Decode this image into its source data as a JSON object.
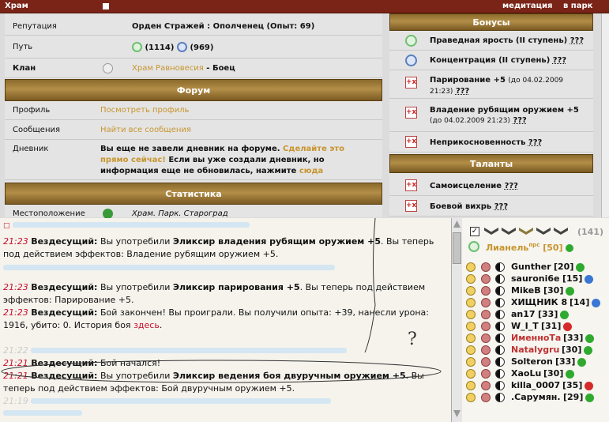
{
  "topbar": {
    "title": "Храм",
    "meditation": "медитация",
    "location": "в парк"
  },
  "profile": {
    "reputation_label": "Репутация",
    "reputation_value": "Орден Стражей : Ополченец (Опыт: 69)",
    "path_label": "Путь",
    "path_green": "(1114)",
    "path_blue": "(969)",
    "clan_label": "Клан",
    "clan_name": "Храм Равновесия",
    "clan_role": " - Боец"
  },
  "forum": {
    "title": "Форум",
    "profile_label": "Профиль",
    "profile_link": "Посмотреть профиль",
    "messages_label": "Сообщения",
    "messages_link": "Найти все сообщения",
    "diary_label": "Дневник",
    "diary_text1": "Вы еще не завели дневник на форуме.",
    "diary_link": "Сделайте это прямо сейчас!",
    "diary_text2": "Если вы уже создали дневник, но информация еще не обновилась, нажмите",
    "diary_link2": "сюда"
  },
  "stats": {
    "title": "Статистика",
    "location_label": "Местоположение",
    "location_value": "Храм. Парк. Староград"
  },
  "bonuses": {
    "title": "Бонусы",
    "items": [
      {
        "name": "Праведная ярость (II ступень)",
        "q": "???",
        "icon": "green-circle-icon"
      },
      {
        "name": "Концентрация (II ступень)",
        "q": "???",
        "icon": "blue-circle-icon"
      },
      {
        "name": "Парирование +5",
        "date": "(до 04.02.2009 21:23)",
        "q": "???",
        "icon": "plus-x-icon"
      },
      {
        "name": "Владение рубящим оружием +5",
        "date": "(до 04.02.2009 21:23)",
        "q": "???",
        "icon": "plus-x-icon"
      },
      {
        "name": "Неприкосновенность",
        "q": "???",
        "icon": "plus-x-icon"
      }
    ]
  },
  "talents": {
    "title": "Таланты",
    "items": [
      {
        "name": "Самоисцеление",
        "q": "???"
      },
      {
        "name": "Боевой вихрь",
        "q": "???"
      }
    ]
  },
  "chat": [
    {
      "time": "21:23",
      "who": "Вездесущий:",
      "text": "Вы употребили ",
      "item": "Эликсир владения рубящим оружием +5",
      "rest": ". Вы теперь под действием эффектов: Владение рубящим оружием +5."
    },
    {
      "time": "21:23",
      "who": "Вездесущий:",
      "text": "Вы употребили ",
      "item": "Эликсир парирования +5",
      "rest": ". Вы теперь под действием эффектов: Парирование +5."
    },
    {
      "time": "21:23",
      "who": "Вездесущий:",
      "text": "Бой закончен! Вы проиграли. Вы получили опыта: +39, нанесли урона: 1916, убито: 0. История боя ",
      "item": "",
      "rest": "",
      "link": "здесь",
      "end": "."
    },
    {
      "time": "21:22",
      "who": "",
      "text": "",
      "item": "",
      "rest": ""
    },
    {
      "time": "21:21",
      "who": "Вездесущий:",
      "text": "Бой начался!",
      "item": "",
      "rest": ""
    },
    {
      "time": "21:21",
      "who": "Вездесущий:",
      "text": "Вы употребили ",
      "item": "Эликсир ведения боя двуручным оружием +5",
      "rest": ". Вы теперь под действием эффектов: Бой двуручным оружием +5."
    },
    {
      "time": "21:19",
      "who": "",
      "text": "",
      "item": "",
      "rest": ""
    }
  ],
  "annotation": "?",
  "users": {
    "count": "(141)",
    "me": "Лианель",
    "me_sup": "прс",
    "me_level": "[50]",
    "list": [
      {
        "name": "Gunther",
        "lvl": "[20]",
        "status": "green",
        "color": "#111"
      },
      {
        "name": "sauroni6e",
        "lvl": "[15]",
        "status": "blue",
        "color": "#111"
      },
      {
        "name": "MikeB",
        "lvl": "[30]",
        "status": "green",
        "color": "#111"
      },
      {
        "name": "ХИЩНИК 8",
        "lvl": "[14]",
        "status": "blue",
        "color": "#111"
      },
      {
        "name": "an17",
        "lvl": "[33]",
        "status": "green",
        "color": "#111"
      },
      {
        "name": "W_I_T",
        "lvl": "[31]",
        "status": "red",
        "color": "#111"
      },
      {
        "name": "ИменноТа",
        "lvl": "[33]",
        "status": "green",
        "color": "#c03030"
      },
      {
        "name": "Natalygru",
        "lvl": "[30]",
        "status": "green",
        "color": "#c03030"
      },
      {
        "name": "Solteron",
        "lvl": "[33]",
        "status": "green",
        "color": "#111"
      },
      {
        "name": "XaoLu",
        "lvl": "[30]",
        "status": "green",
        "color": "#111"
      },
      {
        "name": "killa_0007",
        "lvl": "[35]",
        "status": "red",
        "color": "#111"
      },
      {
        "name": ".Сарумян.",
        "lvl": "[29]",
        "status": "green",
        "color": "#111"
      }
    ]
  }
}
